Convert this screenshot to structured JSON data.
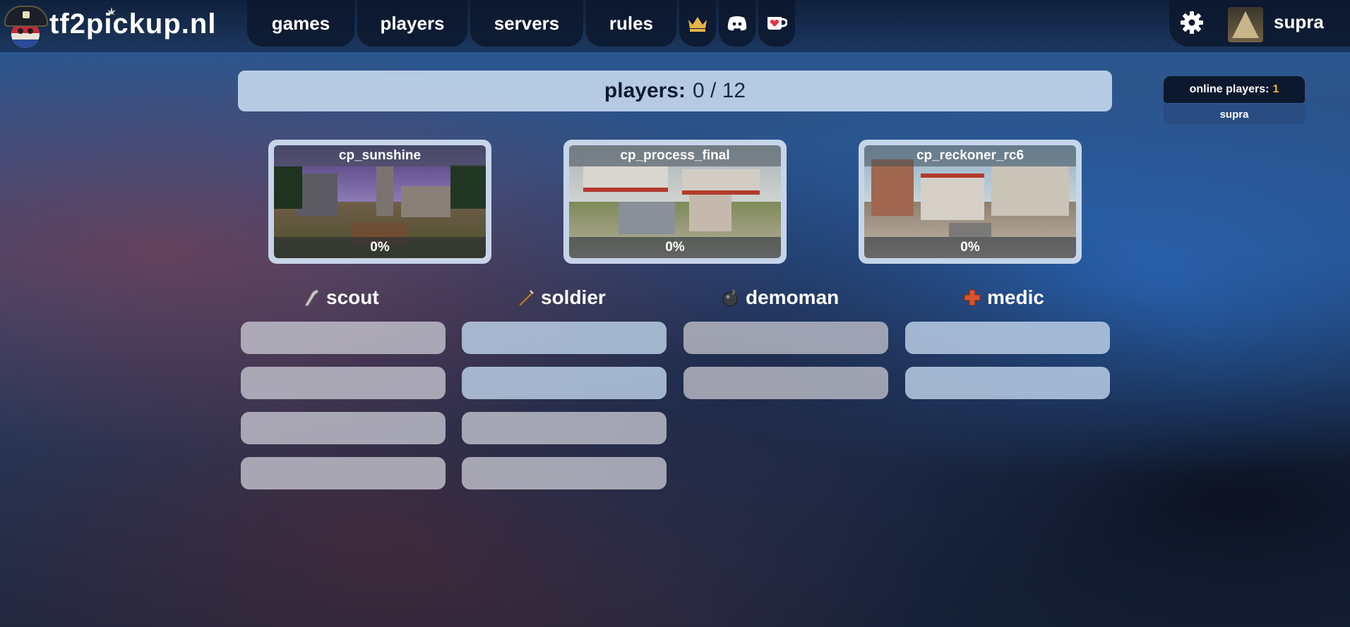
{
  "brand": {
    "name": "tf2pickup.nl"
  },
  "nav": {
    "items": [
      {
        "label": "games"
      },
      {
        "label": "players"
      },
      {
        "label": "servers"
      },
      {
        "label": "rules"
      }
    ],
    "icons": [
      "crown-icon",
      "discord-icon",
      "ko-fi-icon"
    ]
  },
  "user": {
    "name": "supra",
    "settings_icon": "gear-icon"
  },
  "queue": {
    "label": "players:",
    "value": "0 / 12"
  },
  "online": {
    "label": "online players:",
    "count": "1",
    "players": [
      "supra"
    ]
  },
  "maps": [
    {
      "name": "cp_sunshine",
      "percent": "0%"
    },
    {
      "name": "cp_process_final",
      "percent": "0%"
    },
    {
      "name": "cp_reckoner_rc6",
      "percent": "0%"
    }
  ],
  "classes": [
    {
      "name": "scout",
      "icon": "scout-icon",
      "slots": 4
    },
    {
      "name": "soldier",
      "icon": "soldier-icon",
      "slots": 4
    },
    {
      "name": "demoman",
      "icon": "demoman-icon",
      "slots": 2
    },
    {
      "name": "medic",
      "icon": "medic-icon",
      "slots": 2
    }
  ],
  "colors": {
    "accent": "#f2b231",
    "crown": "#e8b34a",
    "medic": "#d9532a"
  }
}
